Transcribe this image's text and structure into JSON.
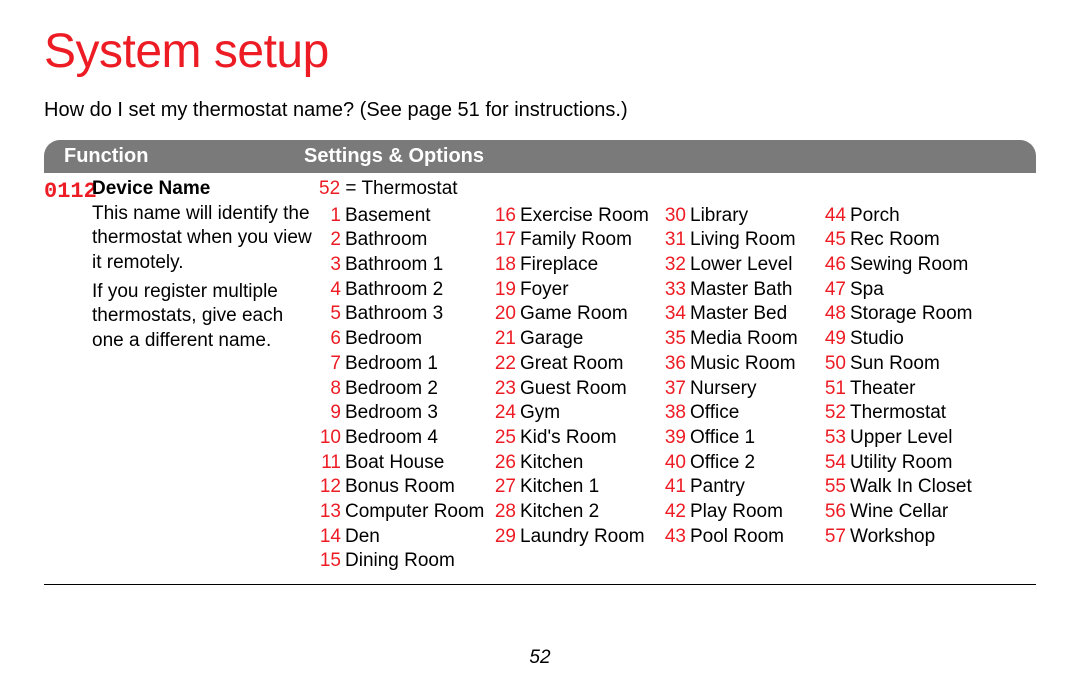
{
  "title": "System setup",
  "intro": "How do I set my thermostat name? (See page 51 for instructions.)",
  "header": {
    "function": "Function",
    "options": "Settings & Options"
  },
  "func": {
    "num": "0112",
    "name": "Device Name",
    "desc1": "This name will identify the thermostat when you view it remotely.",
    "desc2": "If you register multiple thermostats, give each one a different name."
  },
  "default": {
    "num": "52",
    "sep": " = ",
    "label": "Thermostat"
  },
  "columns": [
    [
      {
        "n": "1",
        "name": "Basement"
      },
      {
        "n": "2",
        "name": "Bathroom"
      },
      {
        "n": "3",
        "name": "Bathroom 1"
      },
      {
        "n": "4",
        "name": "Bathroom 2"
      },
      {
        "n": "5",
        "name": "Bathroom 3"
      },
      {
        "n": "6",
        "name": "Bedroom"
      },
      {
        "n": "7",
        "name": "Bedroom 1"
      },
      {
        "n": "8",
        "name": "Bedroom 2"
      },
      {
        "n": "9",
        "name": "Bedroom 3"
      },
      {
        "n": "10",
        "name": "Bedroom 4"
      },
      {
        "n": "11",
        "name": "Boat House"
      },
      {
        "n": "12",
        "name": "Bonus Room"
      },
      {
        "n": "13",
        "name": "Computer Room"
      },
      {
        "n": "14",
        "name": "Den"
      },
      {
        "n": "15",
        "name": "Dining Room"
      }
    ],
    [
      {
        "n": "16",
        "name": "Exercise Room"
      },
      {
        "n": "17",
        "name": "Family Room"
      },
      {
        "n": "18",
        "name": "Fireplace"
      },
      {
        "n": "19",
        "name": "Foyer"
      },
      {
        "n": "20",
        "name": "Game Room"
      },
      {
        "n": "21",
        "name": "Garage"
      },
      {
        "n": "22",
        "name": "Great Room"
      },
      {
        "n": "23",
        "name": "Guest Room"
      },
      {
        "n": "24",
        "name": "Gym"
      },
      {
        "n": "25",
        "name": "Kid's Room"
      },
      {
        "n": "26",
        "name": "Kitchen"
      },
      {
        "n": "27",
        "name": "Kitchen 1"
      },
      {
        "n": "28",
        "name": "Kitchen 2"
      },
      {
        "n": "29",
        "name": "Laundry Room"
      }
    ],
    [
      {
        "n": "30",
        "name": "Library"
      },
      {
        "n": "31",
        "name": "Living Room"
      },
      {
        "n": "32",
        "name": "Lower Level"
      },
      {
        "n": "33",
        "name": "Master Bath"
      },
      {
        "n": "34",
        "name": "Master Bed"
      },
      {
        "n": "35",
        "name": "Media Room"
      },
      {
        "n": "36",
        "name": "Music Room"
      },
      {
        "n": "37",
        "name": "Nursery"
      },
      {
        "n": "38",
        "name": "Office"
      },
      {
        "n": "39",
        "name": "Office 1"
      },
      {
        "n": "40",
        "name": "Office 2"
      },
      {
        "n": "41",
        "name": "Pantry"
      },
      {
        "n": "42",
        "name": "Play Room"
      },
      {
        "n": "43",
        "name": "Pool Room"
      }
    ],
    [
      {
        "n": "44",
        "name": "Porch"
      },
      {
        "n": "45",
        "name": "Rec Room"
      },
      {
        "n": "46",
        "name": "Sewing Room"
      },
      {
        "n": "47",
        "name": "Spa"
      },
      {
        "n": "48",
        "name": "Storage Room"
      },
      {
        "n": "49",
        "name": "Studio"
      },
      {
        "n": "50",
        "name": "Sun Room"
      },
      {
        "n": "51",
        "name": "Theater"
      },
      {
        "n": "52",
        "name": "Thermostat"
      },
      {
        "n": "53",
        "name": "Upper Level"
      },
      {
        "n": "54",
        "name": "Utility Room"
      },
      {
        "n": "55",
        "name": "Walk In Closet"
      },
      {
        "n": "56",
        "name": "Wine Cellar"
      },
      {
        "n": "57",
        "name": "Workshop"
      }
    ]
  ],
  "page_num": "52"
}
